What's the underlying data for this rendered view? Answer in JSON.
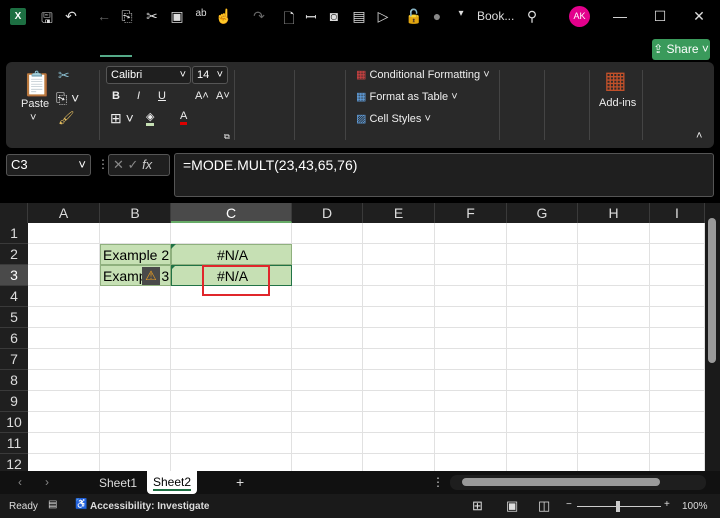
{
  "titlebar": {
    "title": "Book...",
    "avatar": "AK",
    "app_icon": "X"
  },
  "share_label": "Share",
  "ribbon": {
    "paste": "Paste",
    "font_name": "Calibri",
    "font_size": "14",
    "bold": "B",
    "italic": "I",
    "underline": "U",
    "grow": "A˄",
    "shrink": "A˅",
    "font_color": "A",
    "conditional_formatting": "Conditional Formatting",
    "format_as_table": "Format as Table",
    "cell_styles": "Cell Styles",
    "addins": "Add-ins"
  },
  "formula_bar": {
    "name_box": "C3",
    "formula": "=MODE.MULT(23,43,65,76)",
    "fx": "fx"
  },
  "columns": [
    "A",
    "B",
    "C",
    "D",
    "E",
    "F",
    "G",
    "H",
    "I"
  ],
  "rows": [
    "1",
    "2",
    "3",
    "4",
    "5",
    "6",
    "7",
    "8",
    "9",
    "10",
    "11",
    "12"
  ],
  "cells": {
    "B2": "Example 2",
    "C2": "#N/A",
    "B3": "Example 3",
    "C3": "#N/A"
  },
  "sheets": [
    "Sheet1",
    "Sheet2"
  ],
  "active_sheet": "Sheet2",
  "status": {
    "ready": "Ready",
    "accessibility": "Accessibility: Investigate",
    "zoom": "100%"
  },
  "colors": {
    "selected_fill": "#c6e0b4",
    "highlight_box": "#e0262b",
    "share": "#3a9a5b",
    "avatar": "#e3008c"
  }
}
